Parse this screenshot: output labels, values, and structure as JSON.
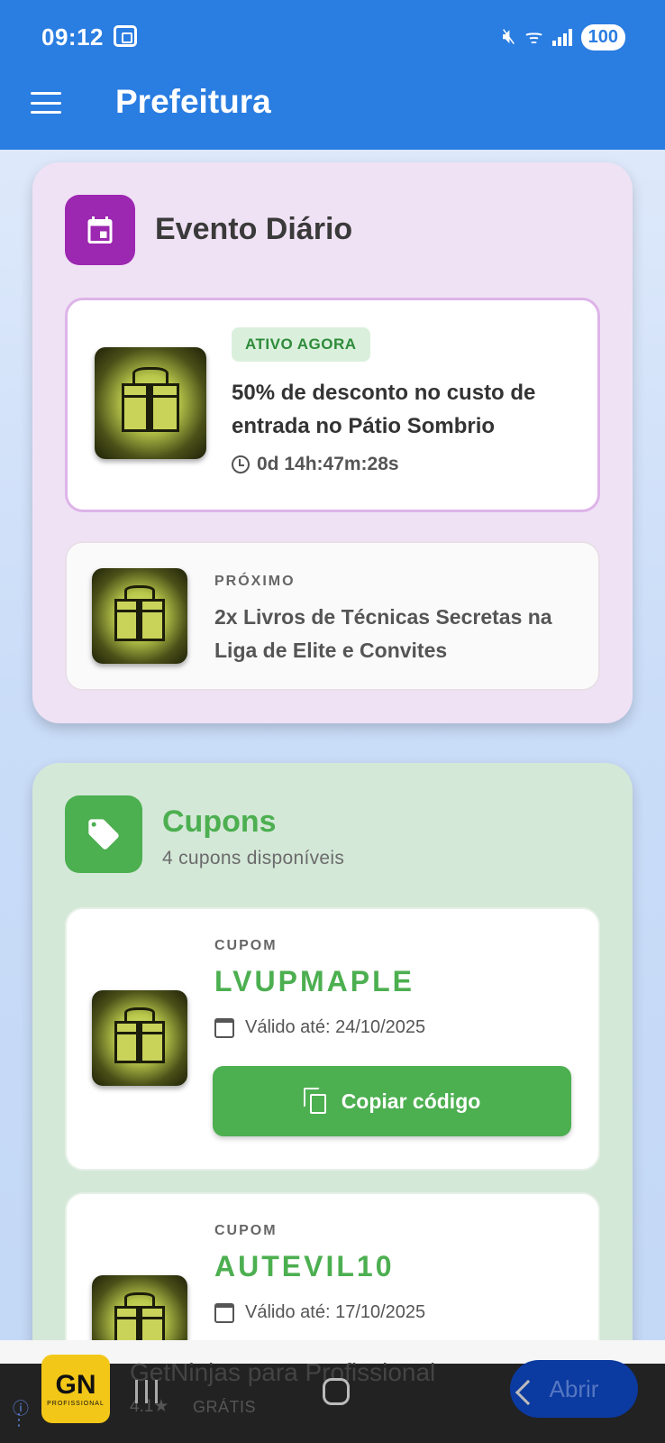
{
  "status_bar": {
    "time": "09:12",
    "battery": "100"
  },
  "app_bar": {
    "title": "Prefeitura",
    "color": "#2a7de1"
  },
  "event_section": {
    "title": "Evento Diário",
    "icon": "calendar-icon",
    "active": {
      "badge": "ATIVO AGORA",
      "text": "50% de desconto no custo de entrada no Pátio Sombrio",
      "timer": "0d 14h:47m:28s"
    },
    "next": {
      "label": "PRÓXIMO",
      "text": "2x Livros de Técnicas Secretas na Liga de Elite e Convites"
    }
  },
  "coupons_section": {
    "title": "Cupons",
    "subtitle": "4 cupons disponíveis",
    "icon": "tag-icon",
    "accent": "#4caf50",
    "items": [
      {
        "label": "CUPOM",
        "code": "LVUPMAPLE",
        "valid": "Válido até: 24/10/2025",
        "button": "Copiar código"
      },
      {
        "label": "CUPOM",
        "code": "AUTEVIL10",
        "valid": "Válido até: 17/10/2025"
      }
    ]
  },
  "ad": {
    "logo": "GN",
    "logo_sub": "PROFISSIONAL",
    "title": "GetNinjas para Profissional",
    "rating": "4.1★",
    "price": "GRÁTIS",
    "button": "Abrir"
  }
}
